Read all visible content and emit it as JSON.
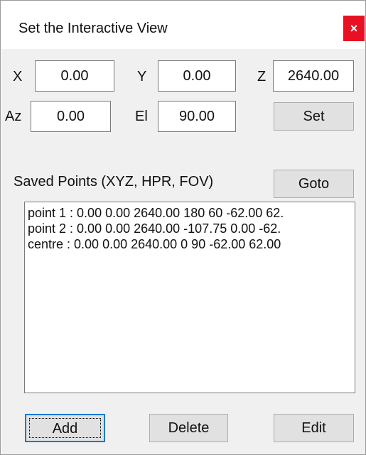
{
  "window": {
    "title": "Set the Interactive View",
    "close_label": "×"
  },
  "position": {
    "x_label": "X",
    "x_value": "0.00",
    "y_label": "Y",
    "y_value": "0.00",
    "z_label": "Z",
    "z_value": "2640.00"
  },
  "orientation": {
    "az_label": "Az",
    "az_value": "0.00",
    "el_label": "El",
    "el_value": "90.00"
  },
  "buttons": {
    "set": "Set",
    "goto": "Goto",
    "add": "Add",
    "delete": "Delete",
    "edit": "Edit"
  },
  "saved_points": {
    "label": "Saved Points (XYZ, HPR, FOV)",
    "items": [
      "point 1 :   0.00 0.00 2640.00 180 60 -62.00 62.",
      "point 2 :   0.00 0.00 2640.00 -107.75 0.00 -62.",
      "centre :   0.00 0.00 2640.00 0 90 -62.00 62.00"
    ]
  },
  "colors": {
    "close_button": "#e81123",
    "dialog_background": "#f0f0f0",
    "default_button_border": "#0078d7"
  }
}
